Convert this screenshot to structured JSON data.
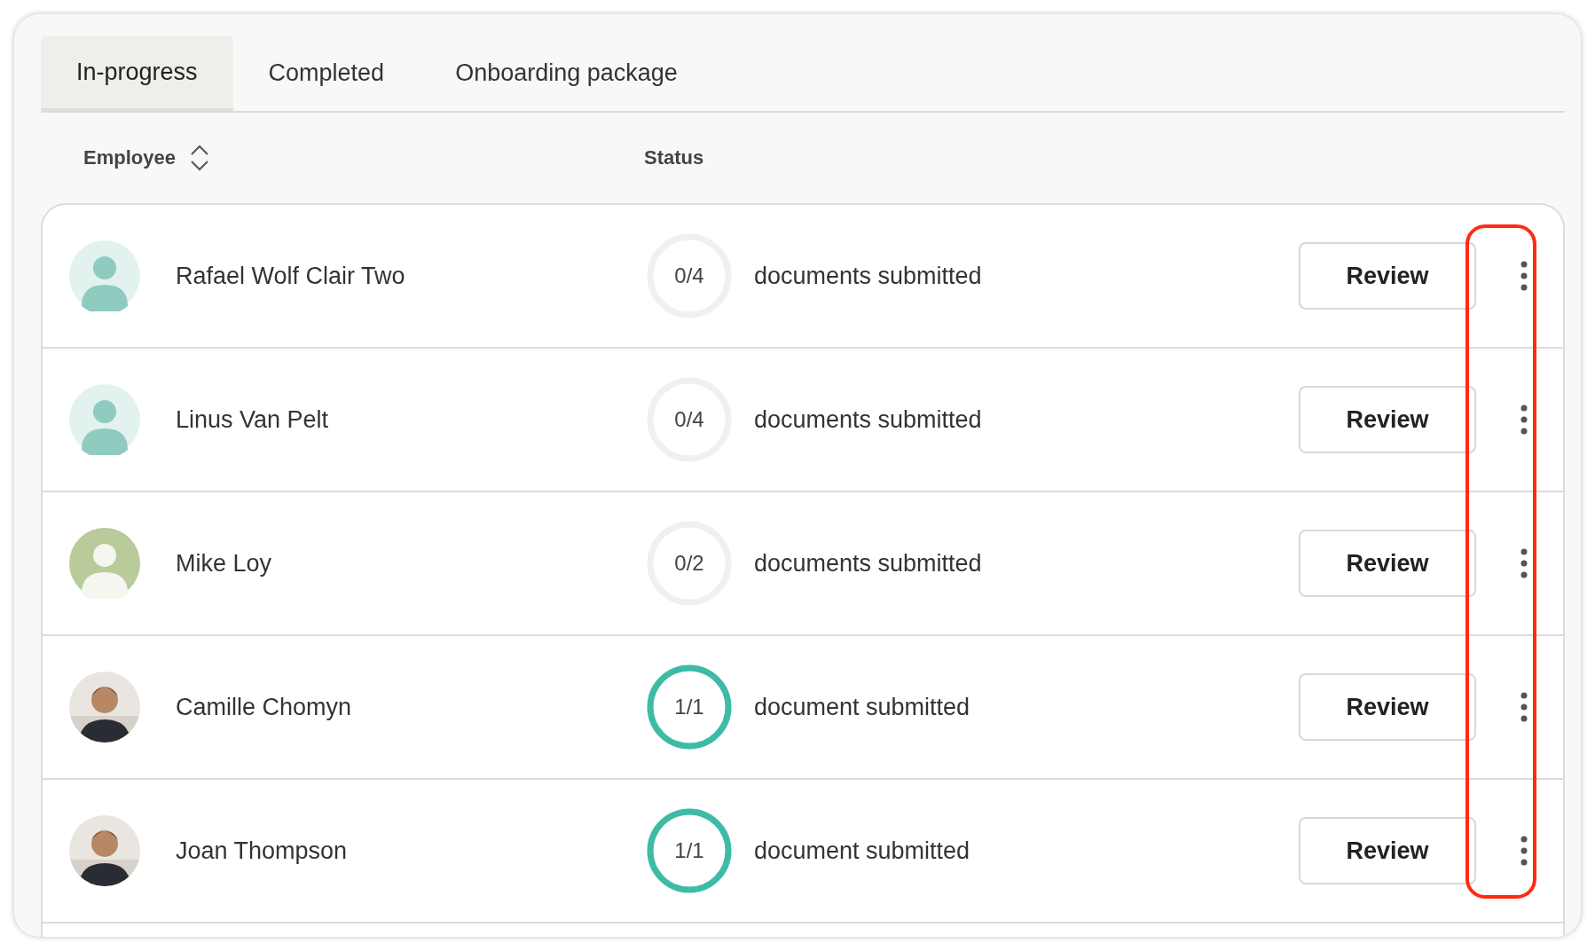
{
  "tabs": [
    {
      "label": "In-progress",
      "selected": true
    },
    {
      "label": "Completed",
      "selected": false
    },
    {
      "label": "Onboarding package",
      "selected": false
    }
  ],
  "columns": [
    {
      "label": "Employee",
      "sortable": true
    },
    {
      "label": "Status",
      "sortable": false
    }
  ],
  "rows": [
    {
      "name": "Rafael Wolf Clair Two",
      "avatar": {
        "kind": "placeholder",
        "color": "#e2f2ee"
      },
      "count": "0/4",
      "level": 0,
      "status": "documents submitted",
      "action": "Review"
    },
    {
      "name": "Linus Van Pelt",
      "avatar": {
        "kind": "placeholder",
        "color": "#e2f2ee"
      },
      "count": "0/4",
      "level": 0,
      "status": "documents submitted",
      "action": "Review"
    },
    {
      "name": "Mike Loy",
      "avatar": {
        "kind": "placeholder",
        "color": "#b9ca9b"
      },
      "count": "0/2",
      "level": 0,
      "status": "documents submitted",
      "action": "Review"
    },
    {
      "name": "Camille Chomyn",
      "count": "1/1",
      "level": 1,
      "status": "document submitted",
      "action": "Review"
    },
    {
      "name": "Joan Thompson",
      "count": "1/1",
      "level": 1,
      "status": "document submitted",
      "action": "Review"
    }
  ]
}
